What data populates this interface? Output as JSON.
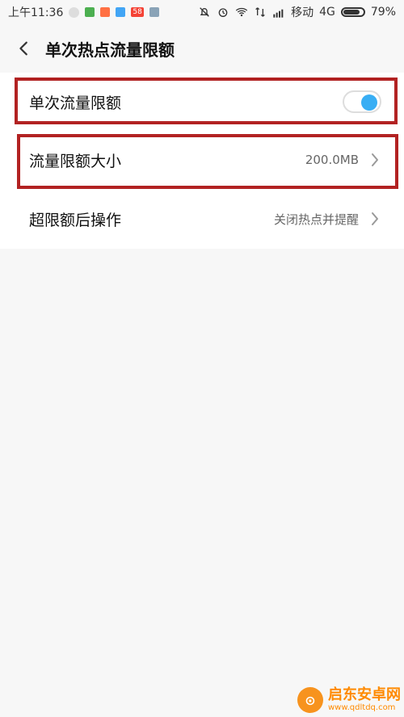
{
  "status_bar": {
    "time": "上午11:36",
    "carrier": "移动",
    "network": "4G",
    "battery": "79%",
    "notification_icons": [
      "clock-notification",
      "green-app",
      "orange-app",
      "blue-app",
      "58-app",
      "gray-app"
    ],
    "badge_58_text": "58"
  },
  "header": {
    "title": "单次热点流量限额"
  },
  "settings": [
    {
      "label": "单次流量限额",
      "type": "toggle",
      "enabled": true
    },
    {
      "label": "流量限额大小",
      "value": "200.0MB"
    },
    {
      "label": "超限额后操作",
      "value": "关闭热点并提醒"
    }
  ],
  "watermark": {
    "cn": "启东安卓网",
    "url": "www.qdltdq.com"
  },
  "colors": {
    "accent": "#38aef4",
    "highlight": "#b22222",
    "background": "#f7f7f7",
    "card": "#ffffff"
  }
}
